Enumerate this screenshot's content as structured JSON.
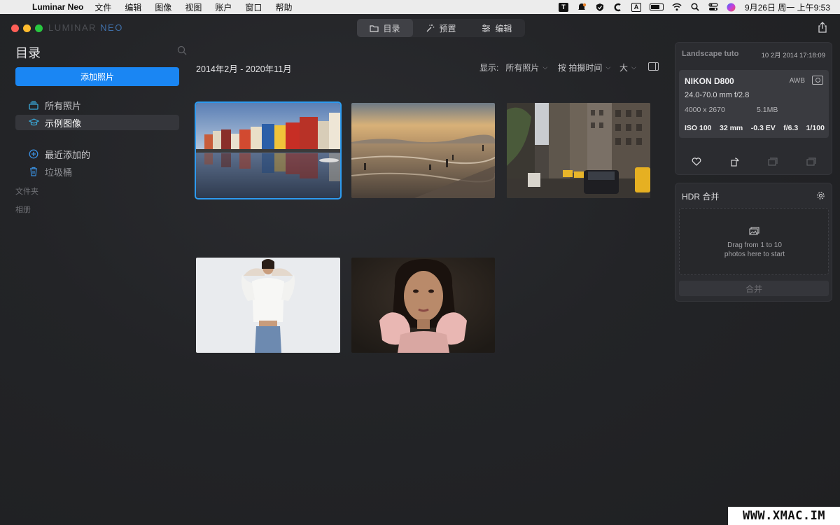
{
  "menubar": {
    "app_name": "Luminar Neo",
    "items": [
      "文件",
      "编辑",
      "图像",
      "视图",
      "账户",
      "窗口",
      "帮助"
    ],
    "status_icons": [
      "t-icon",
      "notification-icon",
      "shield-icon",
      "c-icon",
      "a-icon",
      "battery-icon",
      "wifi-icon",
      "search-icon",
      "control-center-icon",
      "siri-icon"
    ],
    "t_label": "T",
    "a_label": "A",
    "clock": "9月26日 周一 上午9:53"
  },
  "window": {
    "brand_left": "LUMINAR",
    "brand_right": "NEO",
    "tabs": [
      {
        "label": "目录",
        "icon": "folder-icon",
        "active": true
      },
      {
        "label": "预置",
        "icon": "magic-wand-icon",
        "active": false
      },
      {
        "label": "编辑",
        "icon": "sliders-icon",
        "active": false
      }
    ]
  },
  "sidebar": {
    "title": "目录",
    "add_button": "添加照片",
    "items": [
      {
        "label": "所有照片",
        "icon": "photos-stack-icon"
      },
      {
        "label": "示例图像",
        "icon": "graduation-cap-icon"
      },
      {
        "label": "最近添加的",
        "icon": "plus-circle-icon"
      },
      {
        "label": "垃圾桶",
        "icon": "trash-icon"
      }
    ],
    "section_folders": "文件夹",
    "section_albums": "相册"
  },
  "main": {
    "date_range": "2014年2月 - 2020年11月",
    "show_label": "显示:",
    "show_value": "所有照片",
    "sort_value": "按 拍摄时间",
    "size_value": "大",
    "photos": [
      "colorful-harbor-houses",
      "beach-sunset",
      "city-street-taxis",
      "woman-white-shirt",
      "woman-portrait-pink"
    ]
  },
  "info_panel": {
    "file_name": "Landscape tuto",
    "date": "10 2月 2014 17:18:09",
    "camera": "NIKON D800",
    "white_balance": "AWB",
    "lens": "24.0-70.0 mm f/2.8",
    "resolution": "4000 x 2670",
    "file_size": "5.1MB",
    "exif": [
      "ISO 100",
      "32 mm",
      "-0.3 EV",
      "f/6.3",
      "1/100"
    ]
  },
  "hdr_panel": {
    "title": "HDR 合并",
    "drop_line1": "Drag from 1 to 10",
    "drop_line2": "photos here to start",
    "merge_button": "合并"
  },
  "watermark": "WWW.XMAC.IM"
}
